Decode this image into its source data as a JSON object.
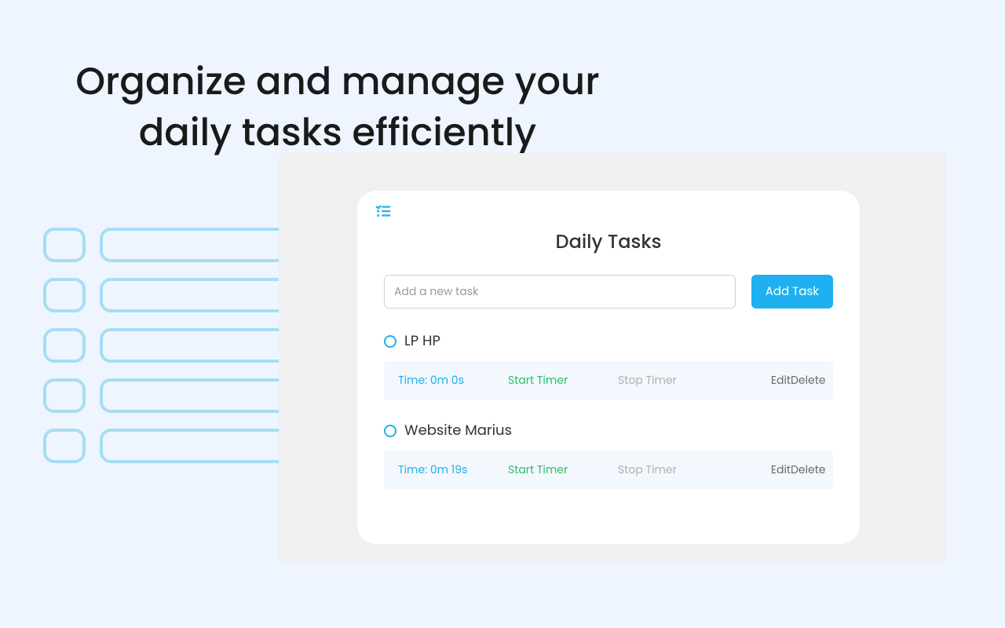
{
  "headline": "Organize and manage your daily tasks efficiently",
  "card": {
    "title": "Daily Tasks",
    "input_placeholder": "Add a new task",
    "add_button_label": "Add Task"
  },
  "task_actions": {
    "start": "Start Timer",
    "stop": "Stop Timer",
    "edit": "Edit",
    "delete": "Delete"
  },
  "tasks": [
    {
      "name": "LP HP",
      "time_label": "Time: 0m 0s"
    },
    {
      "name": "Website Marius",
      "time_label": "Time: 0m 19s"
    }
  ]
}
